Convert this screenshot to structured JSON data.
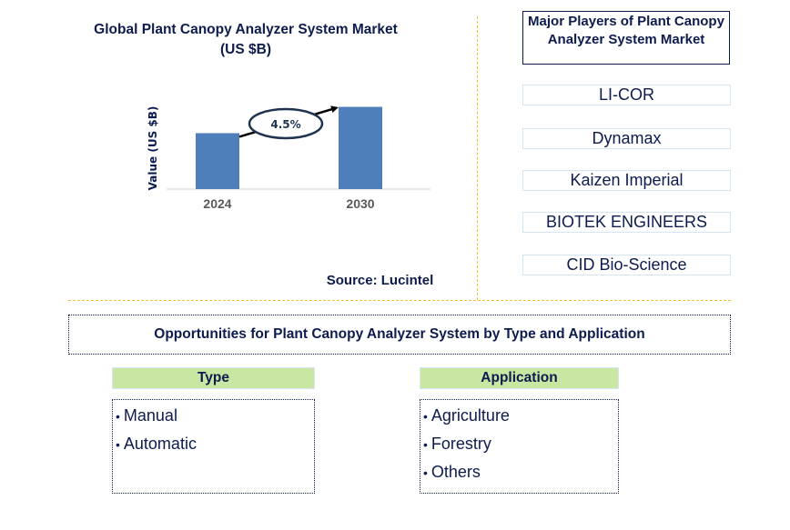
{
  "chart_data": {
    "type": "bar",
    "title": "Global Plant Canopy Analyzer System Market",
    "subtitle": "(US $B)",
    "categories": [
      "2024",
      "2030"
    ],
    "values": [
      0.68,
      1.0
    ],
    "values_note": "relative bar heights (no axis scale shown)",
    "xlabel": "",
    "ylabel": "Value (US $B)",
    "ylim": [
      0,
      1.05
    ],
    "grid": false,
    "annotation": "4.5%",
    "annotation_meaning": "CAGR from 2024 to 2030",
    "bar_color": "#4f7fbb",
    "source": "Source: Lucintel"
  },
  "players": {
    "title": "Major Players of Plant Canopy Analyzer System Market",
    "items": [
      "LI-COR",
      "Dynamax",
      "Kaizen Imperial",
      "BIOTEK ENGINEERS",
      "CID Bio-Science"
    ]
  },
  "opportunities": {
    "title": "Opportunities for Plant Canopy Analyzer System by Type and Application",
    "segments": [
      {
        "header": "Type",
        "items": [
          "Manual",
          "Automatic"
        ]
      },
      {
        "header": "Application",
        "items": [
          "Agriculture",
          "Forestry",
          "Others"
        ]
      }
    ]
  },
  "colors": {
    "text_navy": "#0d1b4f",
    "bar_blue": "#4f7fbb",
    "divider_gold": "#f5c02c",
    "segment_header_green": "#c9e6a3",
    "player_border": "#d3e6f2"
  },
  "bullet": "•"
}
